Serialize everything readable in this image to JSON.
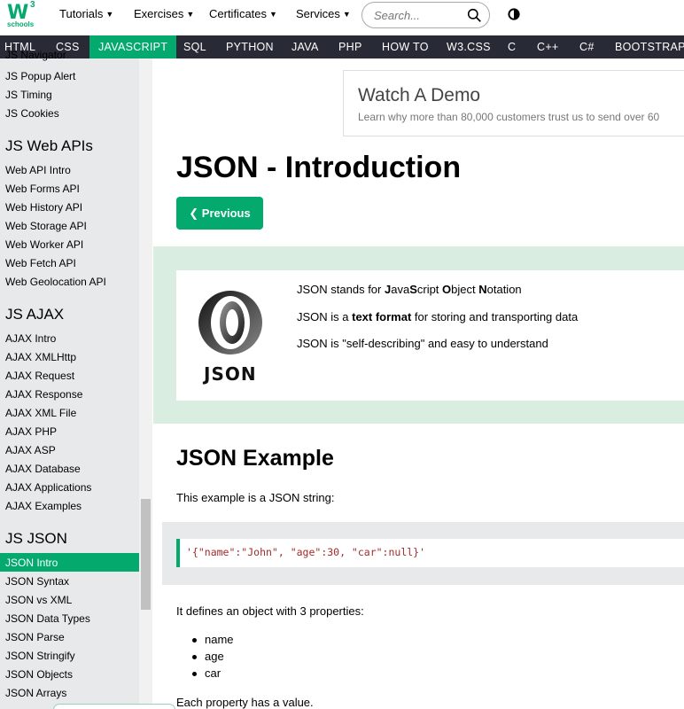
{
  "logo": {
    "mark": "W",
    "superscript": "3",
    "subtitle": "schools"
  },
  "topnav": {
    "items": [
      "Tutorials",
      "Exercises",
      "Certificates",
      "Services"
    ],
    "search_placeholder": "Search...",
    "icons": {
      "search": "search-icon",
      "theme": "contrast-icon",
      "caret": "caret-down-icon"
    }
  },
  "subnav": {
    "items": [
      "HTML",
      "CSS",
      "JAVASCRIPT",
      "SQL",
      "PYTHON",
      "JAVA",
      "PHP",
      "HOW TO",
      "W3.CSS",
      "C",
      "C++",
      "C#",
      "BOOTSTRAP"
    ],
    "active": "JAVASCRIPT"
  },
  "sidebar": {
    "top_links": [
      "JS Navigator",
      "JS Popup Alert",
      "JS Timing",
      "JS Cookies"
    ],
    "sections": [
      {
        "heading": "JS Web APIs",
        "links": [
          "Web API Intro",
          "Web Forms API",
          "Web History API",
          "Web Storage API",
          "Web Worker API",
          "Web Fetch API",
          "Web Geolocation API"
        ]
      },
      {
        "heading": "JS AJAX",
        "links": [
          "AJAX Intro",
          "AJAX XMLHttp",
          "AJAX Request",
          "AJAX Response",
          "AJAX XML File",
          "AJAX PHP",
          "AJAX ASP",
          "AJAX Database",
          "AJAX Applications",
          "AJAX Examples"
        ]
      },
      {
        "heading": "JS JSON",
        "links": [
          "JSON Intro",
          "JSON Syntax",
          "JSON vs XML",
          "JSON Data Types",
          "JSON Parse",
          "JSON Stringify",
          "JSON Objects",
          "JSON Arrays"
        ]
      }
    ],
    "active": "JSON Intro"
  },
  "ad": {
    "title": "Watch A Demo",
    "subtitle": "Learn why more than 80,000 customers trust us to send over 60"
  },
  "main": {
    "title": "JSON - Introduction",
    "prev_label": "Previous",
    "note": {
      "logo_text": "JSON",
      "line1": {
        "pre": "JSON stands for ",
        "j": "J",
        "a": "ava",
        "s": "S",
        "cript": "cript ",
        "o": "O",
        "bject": "bject ",
        "n": "N",
        "otation": "otation"
      },
      "line2": {
        "pre": "JSON is a ",
        "bold": "text format",
        "post": " for storing and transporting data"
      },
      "line3": "JSON is \"self-describing\" and easy to understand"
    },
    "example_heading": "JSON Example",
    "example_intro": "This example is a JSON string:",
    "code": "'{\"name\":\"John\", \"age\":30, \"car\":null}'",
    "defines": "It defines an object with 3 properties:",
    "properties": [
      "name",
      "age",
      "car"
    ],
    "each_value": "Each property has a value."
  },
  "colors": {
    "brand": "#04AA6D",
    "subnav_bg": "#282A35",
    "sidebar_bg": "#E7E9EB",
    "note_bg": "#D9EEE1",
    "code_string": "#A52A2A"
  }
}
